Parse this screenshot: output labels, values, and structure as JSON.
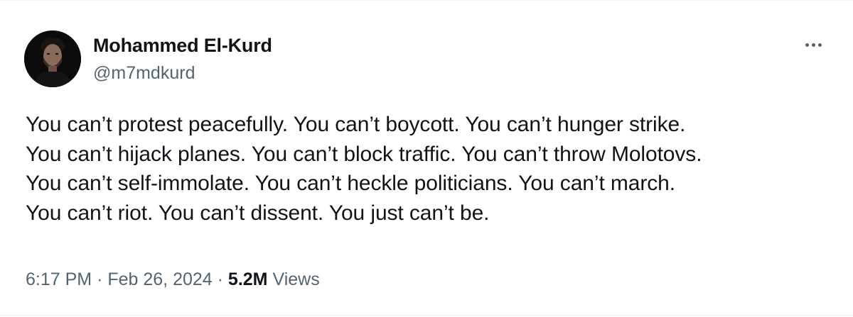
{
  "tweet": {
    "author": {
      "display_name": "Mohammed El-Kurd",
      "handle": "@m7mdkurd"
    },
    "more_icon": "more-horizontal-icon",
    "text": "You can’t protest peacefully. You can’t boycott. You can’t hunger strike.\nYou can’t hijack planes. You can’t block traffic. You can’t throw Molotovs.\nYou can’t self-immolate. You can’t heckle politicians. You can’t march.\nYou can’t riot. You can’t dissent. You just can’t be.",
    "meta": {
      "time": "6:17 PM",
      "separator": "·",
      "date": "Feb 26, 2024",
      "views_count": "5.2M",
      "views_label": "Views"
    }
  },
  "colors": {
    "text_primary": "#0f1419",
    "text_secondary": "#536471",
    "border": "#eff3f4",
    "background": "#ffffff"
  }
}
